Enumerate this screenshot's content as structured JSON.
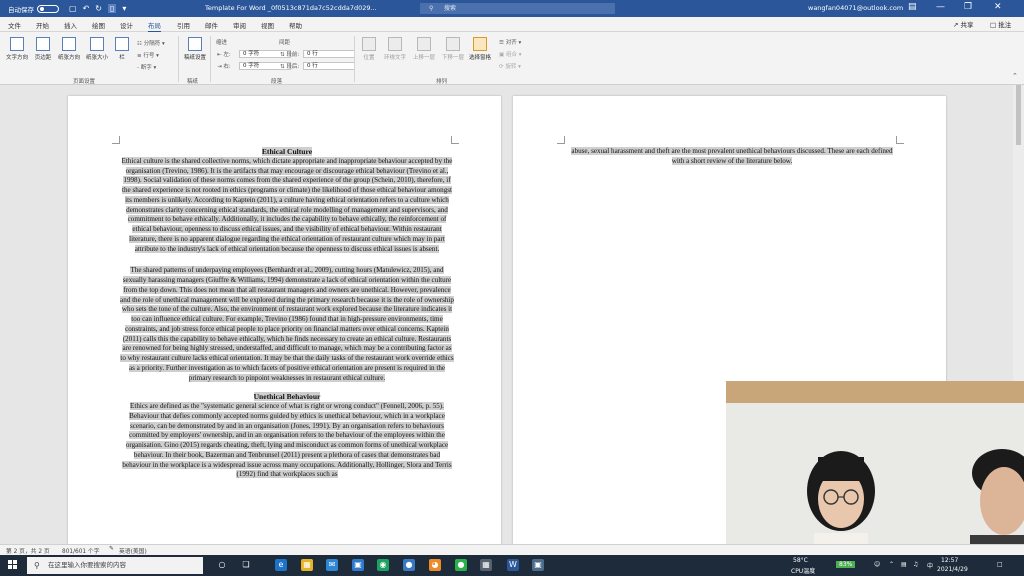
{
  "titlebar": {
    "autosave_label": "自动保存",
    "autosave_state": "关",
    "doc_title": "Template For Word _0f0513c871da7c52cdda7d029...",
    "search_placeholder": "搜索",
    "user_email": "wangfan04071@outlook.com"
  },
  "menu": {
    "tabs": [
      "文件",
      "开始",
      "插入",
      "绘图",
      "设计",
      "布局",
      "引用",
      "邮件",
      "审阅",
      "视图",
      "帮助"
    ],
    "active": "布局",
    "share": "共享",
    "comments": "批注"
  },
  "ribbon": {
    "text_direction": "文字方向",
    "margins": "页边距",
    "orientation": "纸张方向",
    "size": "纸张大小",
    "columns": "栏",
    "breaks": "分隔符",
    "line_numbers": "行号",
    "hyphenation": "断字",
    "page_setup_group": "页面设置",
    "manuscript": "稿纸设置",
    "manuscript_group": "稿纸",
    "indent_label": "缩进",
    "indent_left_label": "左:",
    "indent_left": "0 字符",
    "indent_right_label": "右:",
    "indent_right": "0 字符",
    "spacing_label": "间距",
    "spacing_before_label": "段前:",
    "spacing_before": "0 行",
    "spacing_after_label": "段后:",
    "spacing_after": "0 行",
    "paragraph_group": "段落",
    "position": "位置",
    "wrap_text": "环绕文字",
    "bring_forward": "上移一层",
    "send_backward": "下移一层",
    "selection_pane": "选择窗格",
    "align": "对齐",
    "group": "组合",
    "rotate": "旋转",
    "arrange_group": "排列"
  },
  "page1": {
    "heading1": "Ethical Culture",
    "para1": "Ethical culture is the shared collective norms, which dictate appropriate and inappropriate behaviour accepted by the organisation (Trevino, 1986). It is the artifacts that may encourage or discourage ethical behaviour (Trevino et al., 1998). Social validation of these norms comes from the shared experience of the group (Schein, 2010), therefore, if the shared experience is not rooted in ethics (programs or climate) the likelihood of those ethical behaviour amongst its members is unlikely. According to Kaptein (2011), a culture having ethical orientation refers to a culture which demonstrates clarity concerning ethical standards, the ethical role modelling of management and supervisors, and commitment to behave ethically. Additionally, it includes the capability to behave ethically, the reinforcement of ethical behaviour, openness to discuss ethical issues, and the visibility of ethical behaviour. Within restaurant literature, there is no apparent dialogue regarding the ethical orientation of restaurant culture which may in part attribute to the industry's lack of ethical orientation because the openness to discuss ethical issues is absent.",
    "para2": "The shared patterns of underpaying employees (Bernhardt et al., 2009), cutting hours (Matulewicz, 2015), and sexually harassing managers (Giuffre & Williams, 1994) demonstrate a lack of ethical orientation within the culture from the top down. This does not mean that all restaurant managers and owners are unethical. However, prevalence and the role of unethical management will be explored during the primary research because it is the role of ownership who sets the tone of the culture. Also, the environment of restaurant work explored because the literature indicates it too can influence ethical culture. For example, Trevino (1986) found that in high-pressure environments, time constraints, and job stress force ethical people to place priority on financial matters over ethical concerns. Kaptein (2011) calls this the capability to behave ethically, which he finds necessary to create an ethical culture. Restaurants are renowned for being highly stressed, understaffed, and difficult to manage, which may be a contributing factor as to why restaurant culture lacks ethical orientation. It may be that the daily tasks of the restaurant work override ethics as a priority. Further investigation as to which facets of positive ethical orientation are present is required in the primary research to pinpoint weaknesses in restaurant ethical culture.",
    "heading2": "Unethical Behaviour",
    "para3": "Ethics are defined as the \"systematic general science of what is right or wrong conduct\" (Fennell, 2006, p. 55). Behaviour that defies commonly accepted norms guided by ethics is unethical behaviour, which in a workplace scenario, can be demonstrated by and in an organisation (Jones, 1991). By an organisation refers to behaviours committed by employers' ownership, and in an organisation refers to the behaviour of the employees within the organisation. Gino (2015) regards cheating, theft, lying and misconduct as common forms of unethical workplace behaviour. In their book, Bazerman and Tenbrunsel (2011) present a plethora of cases that demonstrates bad behaviour in the workplace is a widespread issue across many occupations. Additionally, Hollinger, Slora and Terris (1992) find that workplaces such as"
  },
  "page2": {
    "para1": "abuse, sexual harassment and theft are the most prevalent unethical behaviours discussed. These are each defined with a short review of the literature below."
  },
  "status": {
    "page": "第 2 页，共 2 页",
    "words": "801/601 个字",
    "language": "英语(美国)"
  },
  "taskbar": {
    "search_placeholder": "在这里输入你要搜索的内容",
    "weather_temp": "58°C",
    "weather_label": "CPU温度",
    "battery": "83%",
    "ime": "中",
    "time": "12:57",
    "date": "2021/4/29"
  }
}
